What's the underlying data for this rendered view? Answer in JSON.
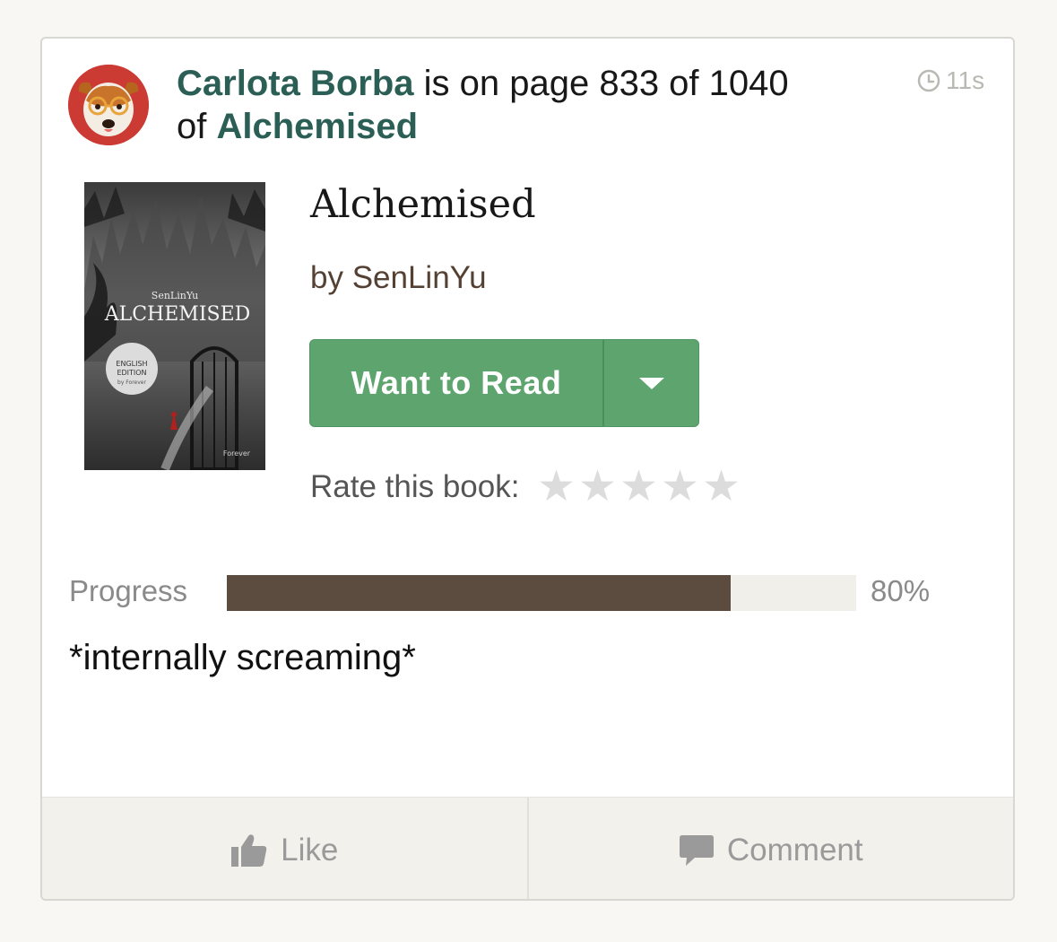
{
  "update": {
    "user_name": "Carlota Borba",
    "status_text": "is on page 833 of 1040",
    "of_text": "of",
    "book_link": "Alchemised",
    "timestamp": "11s",
    "comment": "*internally screaming*"
  },
  "book": {
    "title": "Alchemised",
    "author": "by SenLinYu",
    "cover": {
      "author": "SenLinYu",
      "title": "ALCHEMISED",
      "badge_line1": "ENGLISH",
      "badge_line2": "EDITION",
      "badge_line3": "by Forever",
      "publisher": "Forever"
    }
  },
  "shelf_button": {
    "label": "Want to Read"
  },
  "rating": {
    "label": "Rate this book:",
    "max_stars": 5,
    "value": 0
  },
  "progress": {
    "label": "Progress",
    "percent_text": "80%",
    "fraction": 0.8
  },
  "footer": {
    "like_label": "Like",
    "comment_label": "Comment"
  },
  "colors": {
    "link": "#2b5f56",
    "button": "#5da46f",
    "progress_fill": "#5c4c3f",
    "avatar_bg": "#cc3a34"
  }
}
